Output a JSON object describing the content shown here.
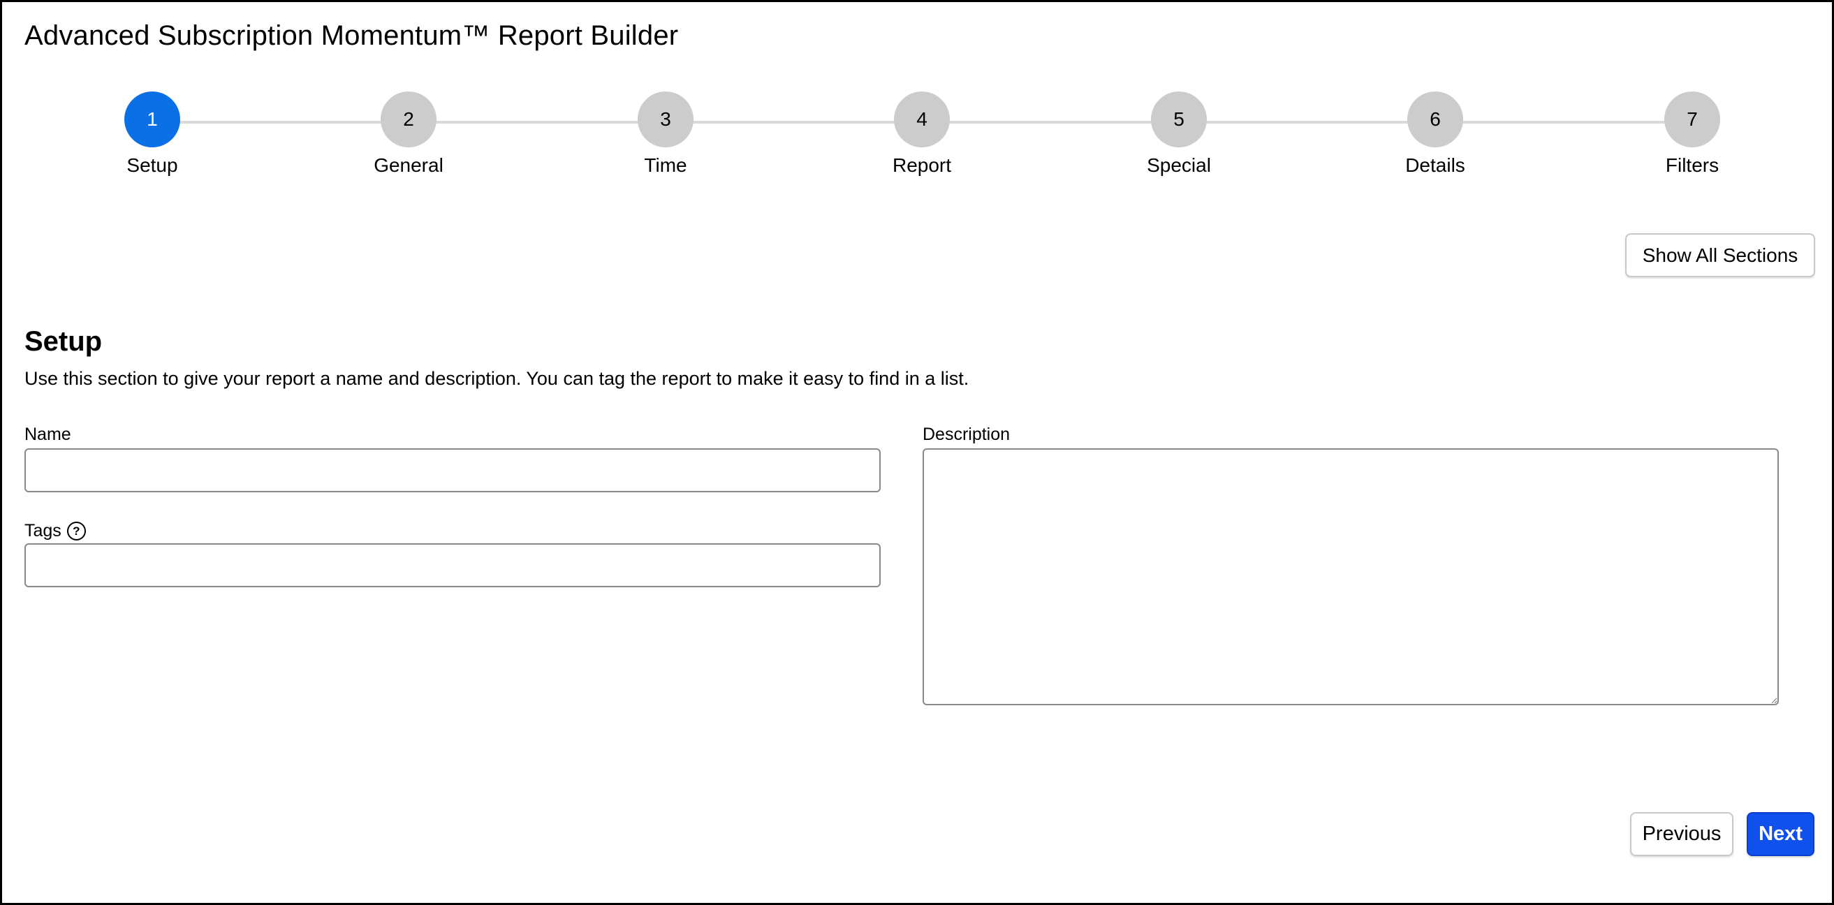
{
  "app": {
    "title": "Advanced Subscription Momentum™ Report Builder"
  },
  "stepper": {
    "steps": [
      {
        "number": "1",
        "label": "Setup",
        "active": true
      },
      {
        "number": "2",
        "label": "General",
        "active": false
      },
      {
        "number": "3",
        "label": "Time",
        "active": false
      },
      {
        "number": "4",
        "label": "Report",
        "active": false
      },
      {
        "number": "5",
        "label": "Special",
        "active": false
      },
      {
        "number": "6",
        "label": "Details",
        "active": false
      },
      {
        "number": "7",
        "label": "Filters",
        "active": false
      }
    ]
  },
  "toolbar": {
    "show_all_label": "Show All Sections"
  },
  "section": {
    "title": "Setup",
    "description": "Use this section to give your report a name and description. You can tag the report to make it easy to find in a list."
  },
  "form": {
    "name": {
      "label": "Name",
      "value": "",
      "placeholder": ""
    },
    "tags": {
      "label": "Tags",
      "help_icon": "question-circle-icon",
      "value": "",
      "placeholder": ""
    },
    "description": {
      "label": "Description",
      "value": "",
      "placeholder": ""
    }
  },
  "nav": {
    "previous_label": "Previous",
    "next_label": "Next"
  },
  "colors": {
    "active_step": "#0b6fe6",
    "inactive_step": "#cccccc",
    "primary_button": "#1050ec"
  }
}
